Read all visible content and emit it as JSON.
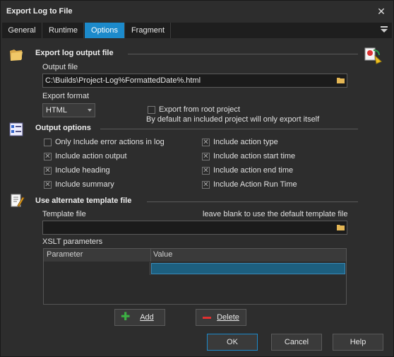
{
  "window": {
    "title": "Export Log to File"
  },
  "tabs": [
    {
      "label": "General"
    },
    {
      "label": "Runtime"
    },
    {
      "label": "Options",
      "active": true
    },
    {
      "label": "Fragment"
    }
  ],
  "export_section": {
    "title": "Export log output file",
    "output_file_label": "Output file",
    "output_file_value": "C:\\Builds\\Project-Log%FormattedDate%.html",
    "export_format_label": "Export format",
    "export_format_value": "HTML",
    "root_project_label": "Export from root project",
    "root_project_checked": false,
    "root_project_note": "By default an included project will only export itself"
  },
  "output_options": {
    "title": "Output options",
    "items": [
      {
        "label": "Only Include error actions in log",
        "checked": false
      },
      {
        "label": "Include action output",
        "checked": true
      },
      {
        "label": "Include heading",
        "checked": true
      },
      {
        "label": "Include summary",
        "checked": true
      },
      {
        "label": "Include action type",
        "checked": true
      },
      {
        "label": "Include action start time",
        "checked": true
      },
      {
        "label": "Include action end time",
        "checked": true
      },
      {
        "label": "Include Action Run Time",
        "checked": true
      }
    ]
  },
  "template_section": {
    "title": "Use alternate template file",
    "template_label": "Template file",
    "template_hint": "leave blank to use the default template file",
    "template_value": "",
    "xslt_label": "XSLT parameters",
    "columns": [
      "Parameter",
      "Value"
    ]
  },
  "buttons": {
    "add": "Add",
    "delete": "Delete",
    "ok": "OK",
    "cancel": "Cancel",
    "help": "Help"
  },
  "colors": {
    "accent": "#1c8acb",
    "background": "#2d2d2d"
  }
}
